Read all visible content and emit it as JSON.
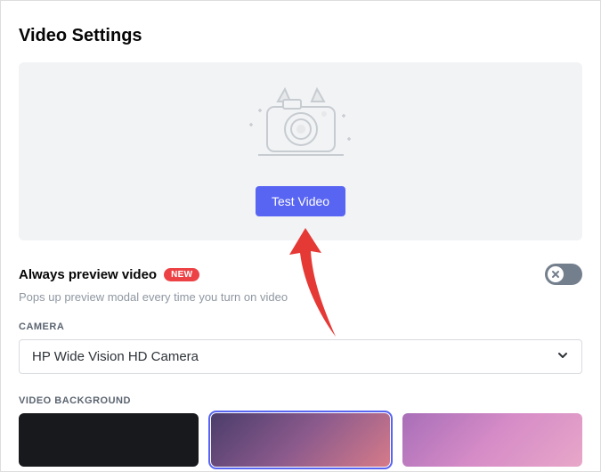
{
  "title": "Video Settings",
  "preview": {
    "test_button": "Test Video"
  },
  "always_preview": {
    "label": "Always preview video",
    "badge": "NEW",
    "description": "Pops up preview modal every time you turn on video",
    "enabled": false
  },
  "camera": {
    "section_label": "CAMERA",
    "selected": "HP Wide Vision HD Camera"
  },
  "video_background": {
    "section_label": "VIDEO BACKGROUND"
  }
}
